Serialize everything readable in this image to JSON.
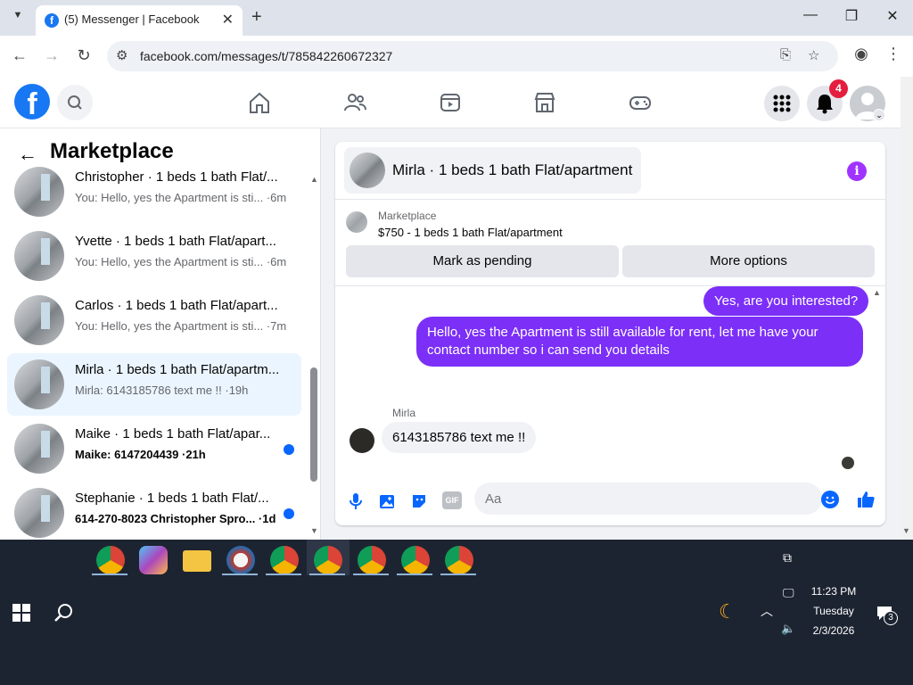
{
  "browser": {
    "tab_title": "(5) Messenger | Facebook",
    "tab_favicon": "f",
    "url": "facebook.com/messages/t/785842260672327"
  },
  "fb": {
    "notification_count": "4"
  },
  "left_panel": {
    "title": "Marketplace",
    "conversations": [
      {
        "name": "Christopher · 1 beds 1 bath Flat/...",
        "preview": "You: Hello, yes the Apartment is sti... ·6m",
        "unread": false,
        "active": false
      },
      {
        "name": "Yvette · 1 beds 1 bath Flat/apart...",
        "preview": "You: Hello, yes the Apartment is sti... ·6m",
        "unread": false,
        "active": false
      },
      {
        "name": "Carlos · 1 beds 1 bath Flat/apart...",
        "preview": "You: Hello, yes the Apartment is sti... ·7m",
        "unread": false,
        "active": false
      },
      {
        "name": "Mirla · 1 beds 1 bath Flat/apartm...",
        "preview": "Mirla: 6143185786 text me !! ·19h",
        "unread": false,
        "active": true
      },
      {
        "name": "Maike · 1 beds 1 bath Flat/apar...",
        "preview": "Maike: 6147204439 ·21h",
        "unread": true,
        "active": false
      },
      {
        "name": "Stephanie · 1 beds 1 bath Flat/...",
        "preview": "614-270-8023 Christopher Spro... ·1d",
        "unread": true,
        "active": false
      }
    ]
  },
  "chat": {
    "header_title": "Mirla · 1 beds 1 bath Flat/apartment",
    "listing_source": "Marketplace",
    "listing_price_title": "$750 - 1 beds 1 bath Flat/apartment",
    "mark_pending_label": "Mark as pending",
    "more_options_label": "More options",
    "messages": [
      {
        "from": "me",
        "text": "Yes, are you interested?"
      },
      {
        "from": "me",
        "text": "Hello, yes the Apartment is still available for rent, let me have your contact number so i can send you details"
      },
      {
        "from": "Mirla",
        "text": "6143185786 text me !!"
      }
    ],
    "sender_label": "Mirla",
    "input_placeholder": "Aa"
  },
  "taskbar": {
    "time": "11:23 PM",
    "day": "Tuesday",
    "date": "2/3/2026",
    "notification_count": "3"
  },
  "colors": {
    "fb_blue": "#1877f2",
    "outgoing_bubble": "#7b2ff7",
    "unread_dot": "#0866ff"
  }
}
